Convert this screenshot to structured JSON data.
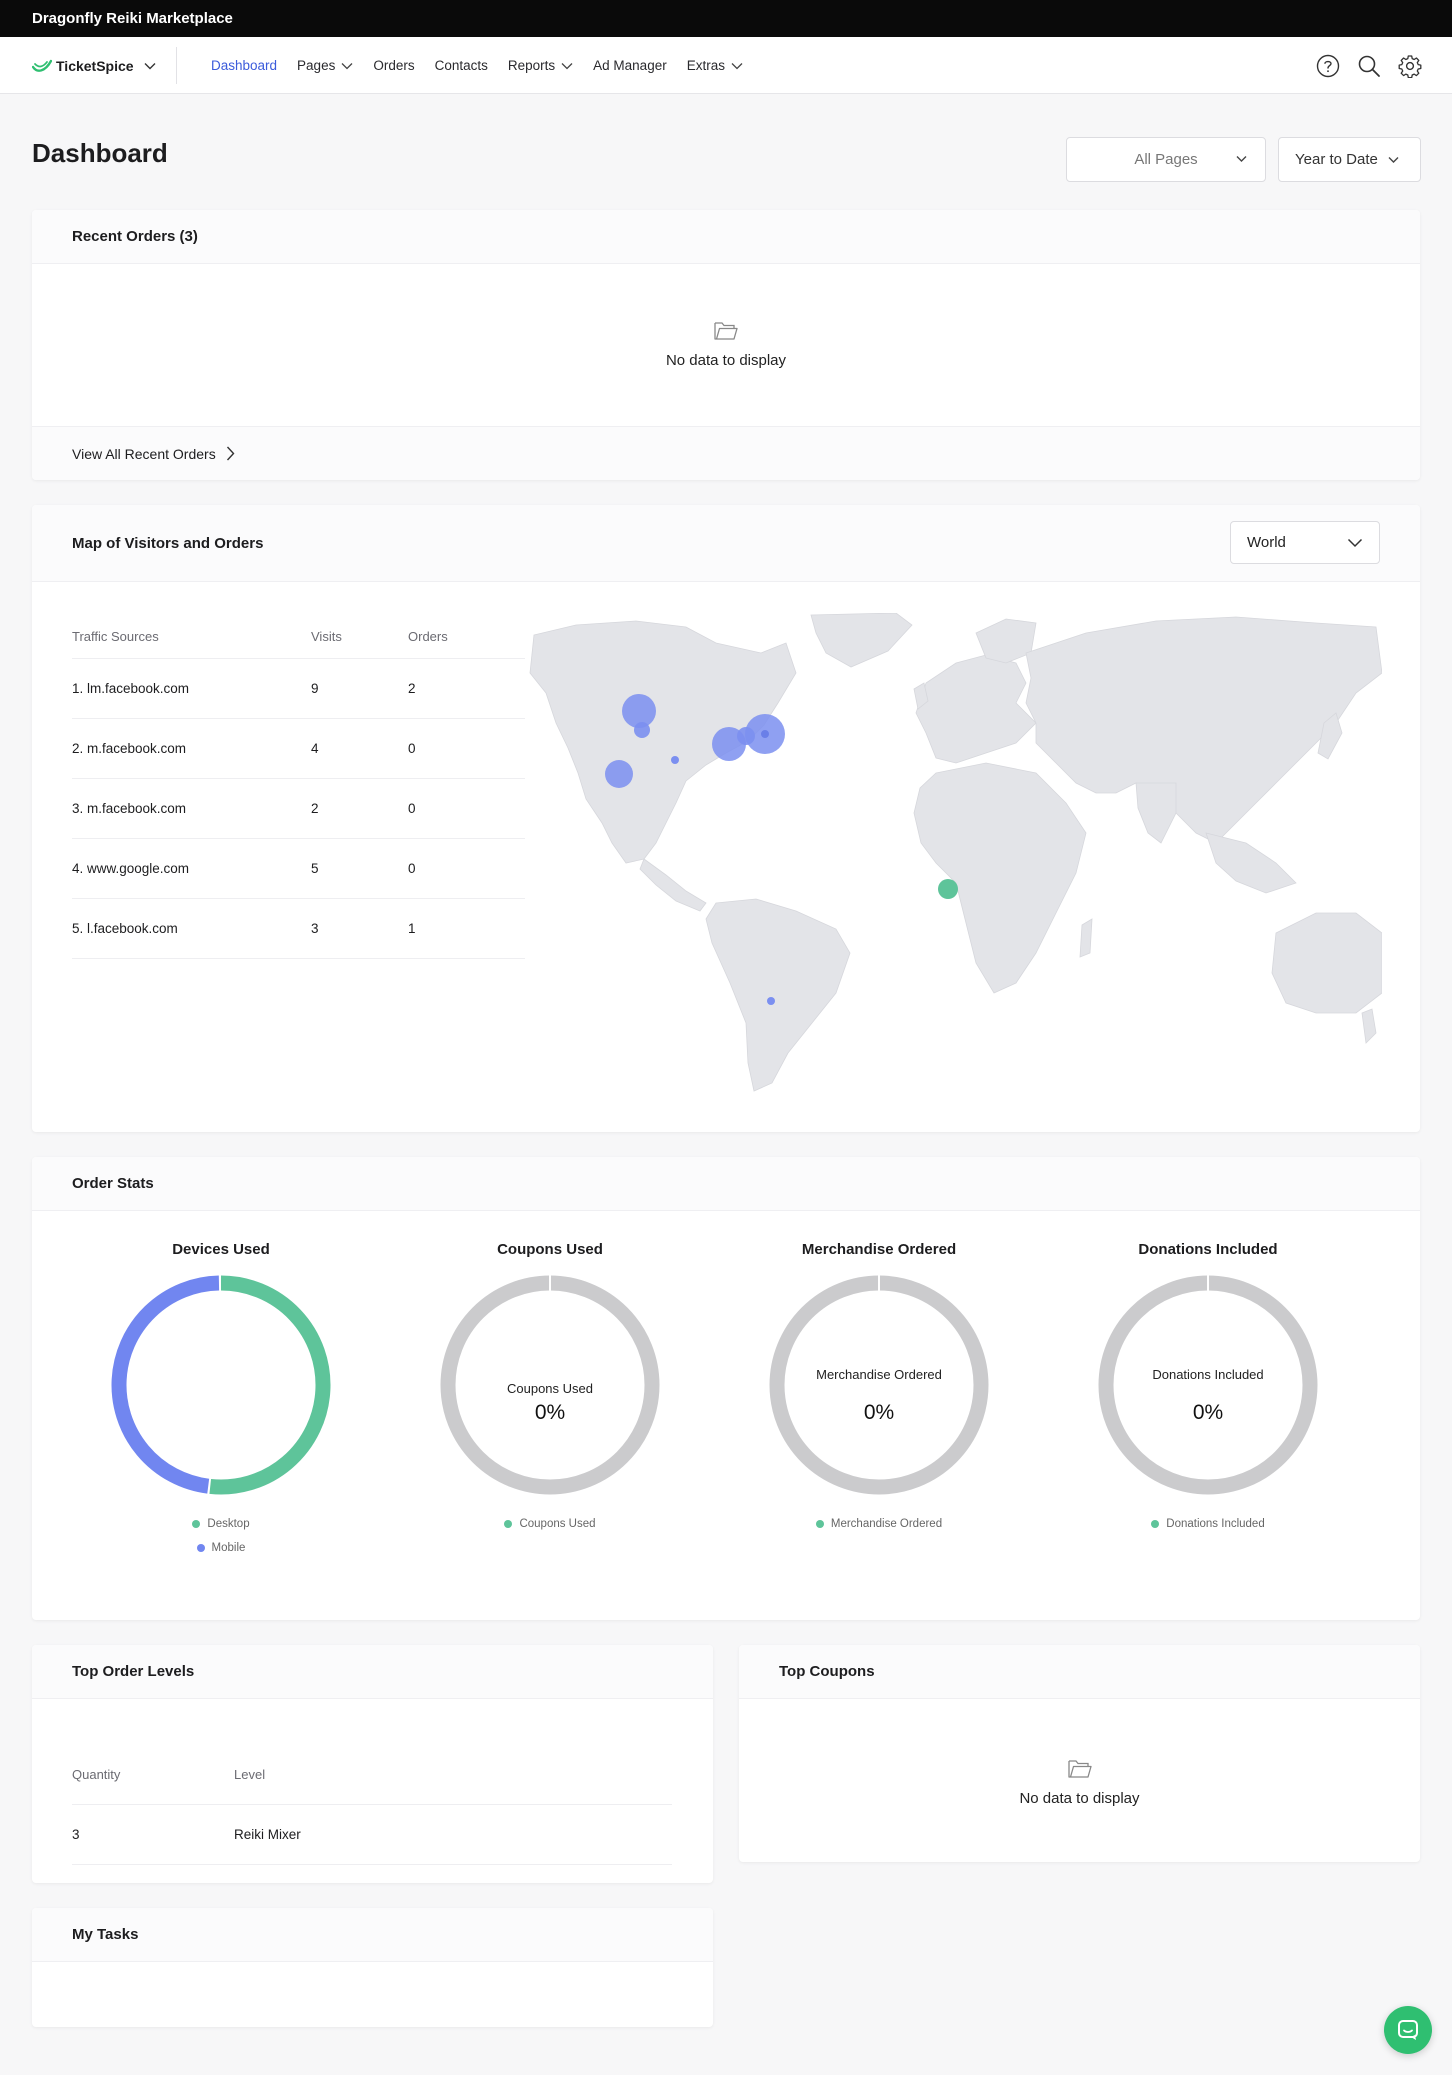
{
  "account_name": "Dragonfly Reiki Marketplace",
  "brand": {
    "name": "TicketSpice",
    "color": "#2fbf71"
  },
  "nav": {
    "items": [
      {
        "label": "Dashboard",
        "active": true,
        "dropdown": false
      },
      {
        "label": "Pages",
        "active": false,
        "dropdown": true
      },
      {
        "label": "Orders",
        "active": false,
        "dropdown": false
      },
      {
        "label": "Contacts",
        "active": false,
        "dropdown": false
      },
      {
        "label": "Reports",
        "active": false,
        "dropdown": true
      },
      {
        "label": "Ad Manager",
        "active": false,
        "dropdown": false
      },
      {
        "label": "Extras",
        "active": false,
        "dropdown": true
      }
    ],
    "icons": [
      "help-icon",
      "search-icon",
      "settings-icon"
    ],
    "active_color": "#3b5bdb"
  },
  "page": {
    "title": "Dashboard",
    "pages_filter": "All Pages",
    "date_filter": "Year to Date"
  },
  "recent_orders": {
    "title": "Recent Orders (3)",
    "empty_text": "No data to display",
    "footer_link": "View All Recent Orders"
  },
  "map_card": {
    "title": "Map of Visitors and Orders",
    "region": "World",
    "columns": [
      "Traffic Sources",
      "Visits",
      "Orders"
    ],
    "rows": [
      {
        "source": "1. lm.facebook.com",
        "visits": "9",
        "orders": "2"
      },
      {
        "source": "2. m.facebook.com",
        "visits": "4",
        "orders": "0"
      },
      {
        "source": "3. m.facebook.com",
        "visits": "2",
        "orders": "0"
      },
      {
        "source": "4. www.google.com",
        "visits": "5",
        "orders": "0"
      },
      {
        "source": "5. l.facebook.com",
        "visits": "3",
        "orders": "1"
      }
    ],
    "visitor_color": "#7b8ff0",
    "order_color": "#5ec49a"
  },
  "order_stats": {
    "title": "Order Stats",
    "charts": [
      {
        "title": "Devices Used",
        "center_label": "",
        "center_value": "",
        "legend": [
          {
            "label": "Desktop",
            "color": "#5ec49a"
          },
          {
            "label": "Mobile",
            "color": "#7186f0"
          }
        ],
        "segments": [
          {
            "label": "Desktop",
            "fraction": 0.52,
            "color": "#5ec49a"
          },
          {
            "label": "Mobile",
            "fraction": 0.48,
            "color": "#7186f0"
          }
        ]
      },
      {
        "title": "Coupons Used",
        "center_label": "Coupons Used",
        "center_value": "0%",
        "legend": [
          {
            "label": "Coupons Used",
            "color": "#5ec49a"
          }
        ],
        "segments": []
      },
      {
        "title": "Merchandise Ordered",
        "center_label": "Merchandise Ordered",
        "center_value": "0%",
        "legend": [
          {
            "label": "Merchandise Ordered",
            "color": "#5ec49a"
          }
        ],
        "segments": []
      },
      {
        "title": "Donations Included",
        "center_label": "Donations Included",
        "center_value": "0%",
        "legend": [
          {
            "label": "Donations Included",
            "color": "#5ec49a"
          }
        ],
        "segments": []
      }
    ]
  },
  "top_order_levels": {
    "title": "Top Order Levels",
    "columns": [
      "Quantity",
      "Level"
    ],
    "rows": [
      {
        "quantity": "3",
        "level": "Reiki Mixer"
      }
    ]
  },
  "top_coupons": {
    "title": "Top Coupons",
    "empty_text": "No data to display"
  },
  "my_tasks": {
    "title": "My Tasks"
  }
}
